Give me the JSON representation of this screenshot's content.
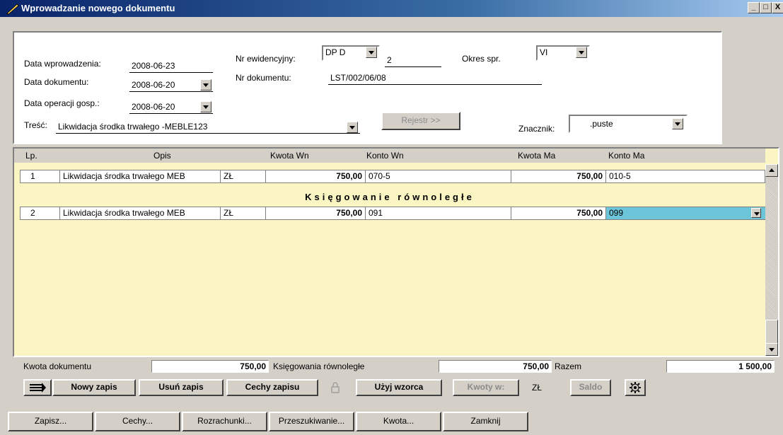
{
  "window": {
    "title": "Wprowadzanie nowego dokumentu",
    "controls": [
      "_",
      "□",
      "X"
    ]
  },
  "header": {
    "data_wprowadzenia_label": "Data wprowadzenia:",
    "data_wprowadzenia_value": "2008-06-23",
    "data_dokumentu_label": "Data dokumentu:",
    "data_dokumentu_value": "2008-06-20",
    "data_operacji_label": "Data operacji gosp.:",
    "data_operacji_value": "2008-06-20",
    "tresc_label": "Treść:",
    "tresc_value": "Likwidacja środka trwałego -MEBLE123",
    "nr_ewidencyjny_label": "Nr ewidencyjny:",
    "nr_ewidencyjny_prefix": "DP  D",
    "nr_ewidencyjny_value": "2",
    "nr_dokumentu_label": "Nr dokumentu:",
    "nr_dokumentu_value": "LST/002/06/08",
    "okres_label": "Okres spr.",
    "okres_value": "VI",
    "rejestr_button": "Rejestr >>",
    "znacznik_label": "Znacznik:",
    "znacznik_value": ".puste"
  },
  "grid": {
    "columns": [
      "Lp.",
      "Opis",
      "Kwota Wn",
      "Konto Wn",
      "Kwota Ma",
      "Konto Ma"
    ],
    "rows": [
      {
        "lp": "1",
        "opis": "Likwidacja środka trwałego MEB",
        "currency": "ZŁ",
        "kwota_wn": "750,00",
        "konto_wn": "070-5",
        "kwota_ma": "750,00",
        "konto_ma": "010-5"
      },
      {
        "lp": "2",
        "opis": "Likwidacja środka trwałego MEB",
        "currency": "ZŁ",
        "kwota_wn": "750,00",
        "konto_wn": "091",
        "kwota_ma": "750,00",
        "konto_ma": "099"
      }
    ],
    "parallel_label": "Księgowanie równoległe"
  },
  "totals": {
    "kwota_dokumentu_label": "Kwota dokumentu",
    "kwota_dokumentu_value": "750,00",
    "ksiegowania_label": "Księgowania równoległe",
    "ksiegowania_value": "750,00",
    "razem_label": "Razem",
    "razem_value": "1 500,00"
  },
  "toolbar": {
    "nowy_zapis": "Nowy zapis",
    "usun_zapis": "Usuń zapis",
    "cechy_zapisu": "Cechy zapisu",
    "uzyj_wzorca": "Użyj wzorca",
    "kwoty_w": "Kwoty w:",
    "currency": "ZŁ",
    "saldo": "Saldo"
  },
  "bottom": {
    "zapisz": "Zapisz...",
    "cechy": "Cechy...",
    "rozrachunki": "Rozrachunki...",
    "przeszukiwanie": "Przeszukiwanie...",
    "kwota": "Kwota...",
    "zamknij": "Zamknij"
  },
  "colors": {
    "titlebar": "#0a246a",
    "grid_background": "#fbf5c4",
    "selected_cell": "#6cc5d9"
  }
}
